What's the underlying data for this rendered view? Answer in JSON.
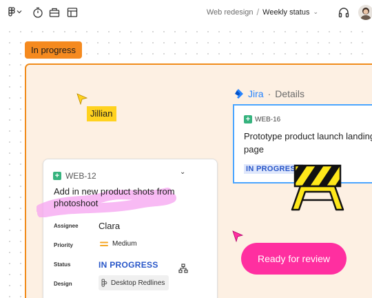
{
  "toolbar": {
    "tools": [
      {
        "icon": "figma-main-menu-icon"
      },
      {
        "icon": "timer-icon"
      },
      {
        "icon": "toolbox-icon"
      },
      {
        "icon": "layout-icon"
      }
    ]
  },
  "breadcrumb": {
    "project": "Web redesign",
    "separator": "/",
    "file": "Weekly status"
  },
  "header_right": {
    "audio_icon": "headphones-icon",
    "avatar_icon": "user-avatar"
  },
  "canvas": {
    "section_label": "In progress",
    "section_color": "#f58a1f",
    "collaborator": {
      "name": "Jillian",
      "color": "#ffd21f"
    },
    "jira_widget": {
      "brand": "Jira",
      "separator": "·",
      "label": "Details",
      "issue_key": "WEB-16",
      "issue_title": "Prototype product launch landing page",
      "status": "IN PROGRESS"
    },
    "ticket": {
      "key": "WEB-12",
      "title": "Add in new product shots from photoshoot",
      "fields": {
        "assignee_label": "Assignee",
        "assignee": "Clara",
        "priority_label": "Priority",
        "priority": "Medium",
        "status_label": "Status",
        "status": "IN PROGRESS",
        "design_label": "Design",
        "design": "Desktop Redlines"
      }
    },
    "review_button": {
      "label": "Ready for review",
      "color": "#ff2fa0"
    },
    "accent_blue": "#2684ff"
  }
}
